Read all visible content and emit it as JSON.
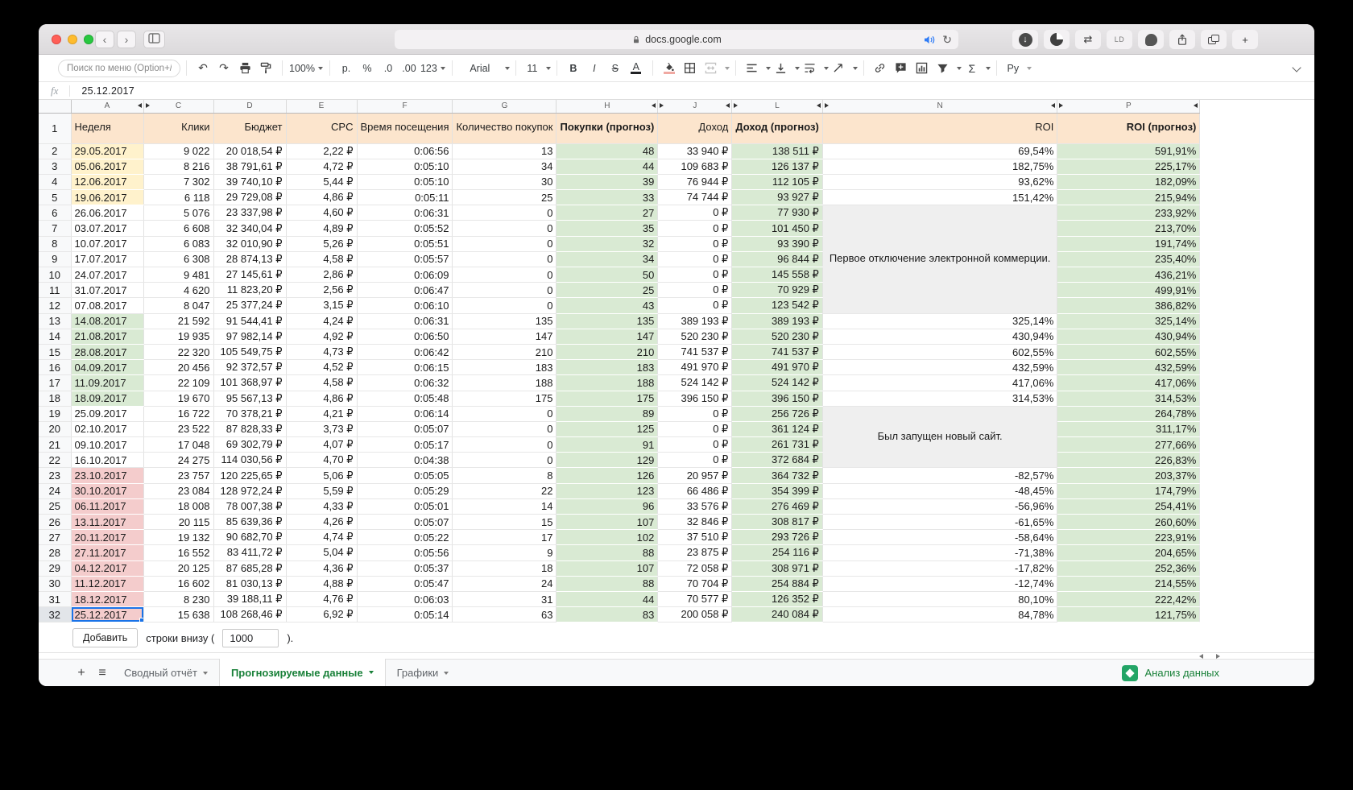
{
  "colors": {
    "accent_green": "#188038",
    "selection_blue": "#1a73e8",
    "header_peach": "#fce5cd",
    "cell_green": "#d9ead3",
    "cell_yellow": "#fff2cc",
    "cell_pink": "#f4cccc",
    "note_gray": "#efefef"
  },
  "browser": {
    "url": "docs.google.com",
    "ld_badge": "LD"
  },
  "icons": {
    "back": "‹",
    "forward": "›",
    "undo": "↶",
    "redo": "↷",
    "reload": "↻",
    "download_arrow": "↓",
    "swap_arrows": "⇄",
    "new_tab": "+",
    "add_sheet": "+",
    "all_sheets": "≡"
  },
  "toolbar": {
    "search_placeholder": "Поиск по меню (Option+/)",
    "zoom": "100%",
    "ruble": "р.",
    "percent": "%",
    "dec0": ".0",
    "dec00": ".00",
    "fmt123": "123",
    "font": "Arial",
    "size": "11",
    "bold": "B",
    "italic": "I",
    "strike": "S",
    "textcolor": "A",
    "sigma": "Σ",
    "lang": "Ру"
  },
  "formula": {
    "fx": "fx",
    "value": "25.12.2017"
  },
  "grid": {
    "columns": [
      {
        "letter": "A",
        "hid_right": true,
        "selected": true
      },
      {
        "letter": "C",
        "hid_left": true
      },
      {
        "letter": "D"
      },
      {
        "letter": "E"
      },
      {
        "letter": "F"
      },
      {
        "letter": "G"
      },
      {
        "letter": "H",
        "hid_right": true
      },
      {
        "letter": "J",
        "hid_left": true,
        "hid_right": true
      },
      {
        "letter": "L",
        "hid_left": true,
        "hid_right": true
      },
      {
        "letter": "N",
        "hid_left": true,
        "hid_right": true
      },
      {
        "letter": "P",
        "hid_left": true,
        "hid_right": true
      }
    ],
    "header": [
      {
        "label": "Неделя"
      },
      {
        "label": "Клики"
      },
      {
        "label": "Бюджет"
      },
      {
        "label": "CPC"
      },
      {
        "label": "Время посещения"
      },
      {
        "label": "Количество покупок"
      },
      {
        "label": "Покупки (прогноз)",
        "bold": true
      },
      {
        "label": "Доход"
      },
      {
        "label": "Доход (прогноз)",
        "bold": true
      },
      {
        "label": "ROI"
      },
      {
        "label": "ROI (прогноз)",
        "bold": true
      }
    ],
    "notes": [
      {
        "start": 6,
        "span": 7,
        "text": "Первое отключение электронной коммерции."
      },
      {
        "start": 19,
        "span": 4,
        "text": "Был запущен новый сайт."
      }
    ],
    "rows": [
      {
        "n": 2,
        "date": "29.05.2017",
        "bg": "yellow",
        "clicks": "9 022",
        "budget": "20 018,54 ₽",
        "cpc": "2,22 ₽",
        "time": "0:06:56",
        "buys": "13",
        "buys_f": "48",
        "rev": "33 940 ₽",
        "rev_f": "138 511 ₽",
        "roi": "69,54%",
        "roi_f": "591,91%"
      },
      {
        "n": 3,
        "date": "05.06.2017",
        "bg": "yellow",
        "clicks": "8 216",
        "budget": "38 791,61 ₽",
        "cpc": "4,72 ₽",
        "time": "0:05:10",
        "buys": "34",
        "buys_f": "44",
        "rev": "109 683 ₽",
        "rev_f": "126 137 ₽",
        "roi": "182,75%",
        "roi_f": "225,17%"
      },
      {
        "n": 4,
        "date": "12.06.2017",
        "bg": "yellow",
        "clicks": "7 302",
        "budget": "39 740,10 ₽",
        "cpc": "5,44 ₽",
        "time": "0:05:10",
        "buys": "30",
        "buys_f": "39",
        "rev": "76 944 ₽",
        "rev_f": "112 105 ₽",
        "roi": "93,62%",
        "roi_f": "182,09%"
      },
      {
        "n": 5,
        "date": "19.06.2017",
        "bg": "yellow",
        "clicks": "6 118",
        "budget": "29 729,08 ₽",
        "cpc": "4,86 ₽",
        "time": "0:05:11",
        "buys": "25",
        "buys_f": "33",
        "rev": "74 744 ₽",
        "rev_f": "93 927 ₽",
        "roi": "151,42%",
        "roi_f": "215,94%"
      },
      {
        "n": 6,
        "date": "26.06.2017",
        "bg": "white",
        "clicks": "5 076",
        "budget": "23 337,98 ₽",
        "cpc": "4,60 ₽",
        "time": "0:06:31",
        "buys": "0",
        "buys_f": "27",
        "rev": "0 ₽",
        "rev_f": "77 930 ₽",
        "roi": null,
        "roi_f": "233,92%"
      },
      {
        "n": 7,
        "date": "03.07.2017",
        "bg": "white",
        "clicks": "6 608",
        "budget": "32 340,04 ₽",
        "cpc": "4,89 ₽",
        "time": "0:05:52",
        "buys": "0",
        "buys_f": "35",
        "rev": "0 ₽",
        "rev_f": "101 450 ₽",
        "roi": null,
        "roi_f": "213,70%"
      },
      {
        "n": 8,
        "date": "10.07.2017",
        "bg": "white",
        "clicks": "6 083",
        "budget": "32 010,90 ₽",
        "cpc": "5,26 ₽",
        "time": "0:05:51",
        "buys": "0",
        "buys_f": "32",
        "rev": "0 ₽",
        "rev_f": "93 390 ₽",
        "roi": null,
        "roi_f": "191,74%"
      },
      {
        "n": 9,
        "date": "17.07.2017",
        "bg": "white",
        "clicks": "6 308",
        "budget": "28 874,13 ₽",
        "cpc": "4,58 ₽",
        "time": "0:05:57",
        "buys": "0",
        "buys_f": "34",
        "rev": "0 ₽",
        "rev_f": "96 844 ₽",
        "roi": null,
        "roi_f": "235,40%"
      },
      {
        "n": 10,
        "date": "24.07.2017",
        "bg": "white",
        "clicks": "9 481",
        "budget": "27 145,61 ₽",
        "cpc": "2,86 ₽",
        "time": "0:06:09",
        "buys": "0",
        "buys_f": "50",
        "rev": "0 ₽",
        "rev_f": "145 558 ₽",
        "roi": null,
        "roi_f": "436,21%"
      },
      {
        "n": 11,
        "date": "31.07.2017",
        "bg": "white",
        "clicks": "4 620",
        "budget": "11 823,20 ₽",
        "cpc": "2,56 ₽",
        "time": "0:06:47",
        "buys": "0",
        "buys_f": "25",
        "rev": "0 ₽",
        "rev_f": "70 929 ₽",
        "roi": null,
        "roi_f": "499,91%"
      },
      {
        "n": 12,
        "date": "07.08.2017",
        "bg": "white",
        "clicks": "8 047",
        "budget": "25 377,24 ₽",
        "cpc": "3,15 ₽",
        "time": "0:06:10",
        "buys": "0",
        "buys_f": "43",
        "rev": "0 ₽",
        "rev_f": "123 542 ₽",
        "roi": null,
        "roi_f": "386,82%"
      },
      {
        "n": 13,
        "date": "14.08.2017",
        "bg": "green",
        "clicks": "21 592",
        "budget": "91 544,41 ₽",
        "cpc": "4,24 ₽",
        "time": "0:06:31",
        "buys": "135",
        "buys_f": "135",
        "rev": "389 193 ₽",
        "rev_f": "389 193 ₽",
        "roi": "325,14%",
        "roi_f": "325,14%"
      },
      {
        "n": 14,
        "date": "21.08.2017",
        "bg": "green",
        "clicks": "19 935",
        "budget": "97 982,14 ₽",
        "cpc": "4,92 ₽",
        "time": "0:06:50",
        "buys": "147",
        "buys_f": "147",
        "rev": "520 230 ₽",
        "rev_f": "520 230 ₽",
        "roi": "430,94%",
        "roi_f": "430,94%"
      },
      {
        "n": 15,
        "date": "28.08.2017",
        "bg": "green",
        "clicks": "22 320",
        "budget": "105 549,75 ₽",
        "cpc": "4,73 ₽",
        "time": "0:06:42",
        "buys": "210",
        "buys_f": "210",
        "rev": "741 537 ₽",
        "rev_f": "741 537 ₽",
        "roi": "602,55%",
        "roi_f": "602,55%"
      },
      {
        "n": 16,
        "date": "04.09.2017",
        "bg": "green",
        "clicks": "20 456",
        "budget": "92 372,57 ₽",
        "cpc": "4,52 ₽",
        "time": "0:06:15",
        "buys": "183",
        "buys_f": "183",
        "rev": "491 970 ₽",
        "rev_f": "491 970 ₽",
        "roi": "432,59%",
        "roi_f": "432,59%"
      },
      {
        "n": 17,
        "date": "11.09.2017",
        "bg": "green",
        "clicks": "22 109",
        "budget": "101 368,97 ₽",
        "cpc": "4,58 ₽",
        "time": "0:06:32",
        "buys": "188",
        "buys_f": "188",
        "rev": "524 142 ₽",
        "rev_f": "524 142 ₽",
        "roi": "417,06%",
        "roi_f": "417,06%"
      },
      {
        "n": 18,
        "date": "18.09.2017",
        "bg": "green",
        "clicks": "19 670",
        "budget": "95 567,13 ₽",
        "cpc": "4,86 ₽",
        "time": "0:05:48",
        "buys": "175",
        "buys_f": "175",
        "rev": "396 150 ₽",
        "rev_f": "396 150 ₽",
        "roi": "314,53%",
        "roi_f": "314,53%"
      },
      {
        "n": 19,
        "date": "25.09.2017",
        "bg": "white",
        "clicks": "16 722",
        "budget": "70 378,21 ₽",
        "cpc": "4,21 ₽",
        "time": "0:06:14",
        "buys": "0",
        "buys_f": "89",
        "rev": "0 ₽",
        "rev_f": "256 726 ₽",
        "roi": null,
        "roi_f": "264,78%"
      },
      {
        "n": 20,
        "date": "02.10.2017",
        "bg": "white",
        "clicks": "23 522",
        "budget": "87 828,33 ₽",
        "cpc": "3,73 ₽",
        "time": "0:05:07",
        "buys": "0",
        "buys_f": "125",
        "rev": "0 ₽",
        "rev_f": "361 124 ₽",
        "roi": null,
        "roi_f": "311,17%"
      },
      {
        "n": 21,
        "date": "09.10.2017",
        "bg": "white",
        "clicks": "17 048",
        "budget": "69 302,79 ₽",
        "cpc": "4,07 ₽",
        "time": "0:05:17",
        "buys": "0",
        "buys_f": "91",
        "rev": "0 ₽",
        "rev_f": "261 731 ₽",
        "roi": null,
        "roi_f": "277,66%"
      },
      {
        "n": 22,
        "date": "16.10.2017",
        "bg": "white",
        "clicks": "24 275",
        "budget": "114 030,56 ₽",
        "cpc": "4,70 ₽",
        "time": "0:04:38",
        "buys": "0",
        "buys_f": "129",
        "rev": "0 ₽",
        "rev_f": "372 684 ₽",
        "roi": null,
        "roi_f": "226,83%"
      },
      {
        "n": 23,
        "date": "23.10.2017",
        "bg": "pink",
        "clicks": "23 757",
        "budget": "120 225,65 ₽",
        "cpc": "5,06 ₽",
        "time": "0:05:05",
        "buys": "8",
        "buys_f": "126",
        "rev": "20 957 ₽",
        "rev_f": "364 732 ₽",
        "roi": "-82,57%",
        "roi_f": "203,37%"
      },
      {
        "n": 24,
        "date": "30.10.2017",
        "bg": "pink",
        "clicks": "23 084",
        "budget": "128 972,24 ₽",
        "cpc": "5,59 ₽",
        "time": "0:05:29",
        "buys": "22",
        "buys_f": "123",
        "rev": "66 486 ₽",
        "rev_f": "354 399 ₽",
        "roi": "-48,45%",
        "roi_f": "174,79%"
      },
      {
        "n": 25,
        "date": "06.11.2017",
        "bg": "pink",
        "clicks": "18 008",
        "budget": "78 007,38 ₽",
        "cpc": "4,33 ₽",
        "time": "0:05:01",
        "buys": "14",
        "buys_f": "96",
        "rev": "33 576 ₽",
        "rev_f": "276 469 ₽",
        "roi": "-56,96%",
        "roi_f": "254,41%"
      },
      {
        "n": 26,
        "date": "13.11.2017",
        "bg": "pink",
        "clicks": "20 115",
        "budget": "85 639,36 ₽",
        "cpc": "4,26 ₽",
        "time": "0:05:07",
        "buys": "15",
        "buys_f": "107",
        "rev": "32 846 ₽",
        "rev_f": "308 817 ₽",
        "roi": "-61,65%",
        "roi_f": "260,60%"
      },
      {
        "n": 27,
        "date": "20.11.2017",
        "bg": "pink",
        "clicks": "19 132",
        "budget": "90 682,70 ₽",
        "cpc": "4,74 ₽",
        "time": "0:05:22",
        "buys": "17",
        "buys_f": "102",
        "rev": "37 510 ₽",
        "rev_f": "293 726 ₽",
        "roi": "-58,64%",
        "roi_f": "223,91%"
      },
      {
        "n": 28,
        "date": "27.11.2017",
        "bg": "pink",
        "clicks": "16 552",
        "budget": "83 411,72 ₽",
        "cpc": "5,04 ₽",
        "time": "0:05:56",
        "buys": "9",
        "buys_f": "88",
        "rev": "23 875 ₽",
        "rev_f": "254 116 ₽",
        "roi": "-71,38%",
        "roi_f": "204,65%"
      },
      {
        "n": 29,
        "date": "04.12.2017",
        "bg": "pink",
        "clicks": "20 125",
        "budget": "87 685,28 ₽",
        "cpc": "4,36 ₽",
        "time": "0:05:37",
        "buys": "18",
        "buys_f": "107",
        "rev": "72 058 ₽",
        "rev_f": "308 971 ₽",
        "roi": "-17,82%",
        "roi_f": "252,36%"
      },
      {
        "n": 30,
        "date": "11.12.2017",
        "bg": "pink",
        "clicks": "16 602",
        "budget": "81 030,13 ₽",
        "cpc": "4,88 ₽",
        "time": "0:05:47",
        "buys": "24",
        "buys_f": "88",
        "rev": "70 704 ₽",
        "rev_f": "254 884 ₽",
        "roi": "-12,74%",
        "roi_f": "214,55%"
      },
      {
        "n": 31,
        "date": "18.12.2017",
        "bg": "pink",
        "clicks": "8 230",
        "budget": "39 188,11 ₽",
        "cpc": "4,76 ₽",
        "time": "0:06:03",
        "buys": "31",
        "buys_f": "44",
        "rev": "70 577 ₽",
        "rev_f": "126 352 ₽",
        "roi": "80,10%",
        "roi_f": "222,42%"
      },
      {
        "n": 32,
        "date": "25.12.2017",
        "bg": "pink",
        "clicks": "15 638",
        "budget": "108 268,46 ₽",
        "cpc": "6,92 ₽",
        "time": "0:05:14",
        "buys": "63",
        "buys_f": "83",
        "rev": "200 058 ₽",
        "rev_f": "240 084 ₽",
        "roi": "84,78%",
        "roi_f": "121,75%",
        "selected": true
      }
    ]
  },
  "footer": {
    "add_button": "Добавить",
    "rows_text": "строки внизу (",
    "rows_value": "1000",
    "rows_suffix": ")."
  },
  "tabs": [
    {
      "label": "Сводный отчёт"
    },
    {
      "label": "Прогнозируемые данные",
      "active": true
    },
    {
      "label": "Графики"
    }
  ],
  "explore": {
    "label": "Анализ данных"
  }
}
